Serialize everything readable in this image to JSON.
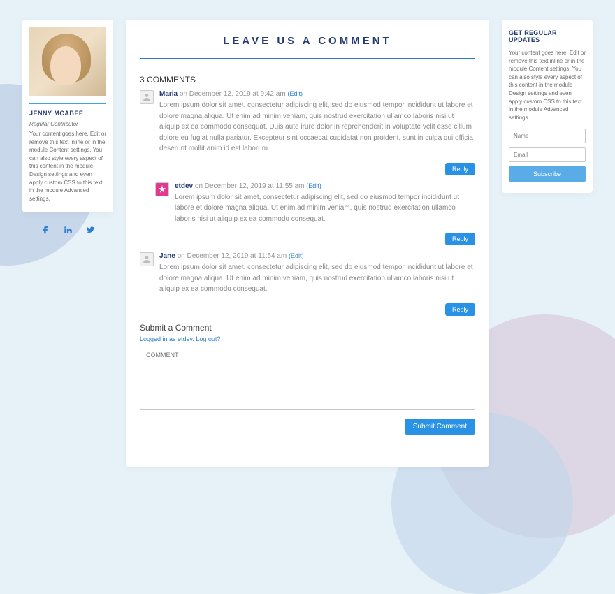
{
  "profile": {
    "name": "JENNY MCABEE",
    "role": "Regular Contributor",
    "description": "Your content goes here. Edit or remove this text inline or in the module Content settings. You can also style every aspect of this content in the module Design settings and even apply custom CSS to this text in the module Advanced settings."
  },
  "main": {
    "title": "LEAVE US A COMMENT",
    "comments_count": "3",
    "comments_label": "COMMENTS",
    "comments": [
      {
        "author": "Maria",
        "date": "on December 12, 2019 at 9:42 am",
        "edit": "(Edit)",
        "text": "Lorem ipsum dolor sit amet, consectetur adipiscing elit, sed do eiusmod tempor incididunt ut labore et dolore magna aliqua. Ut enim ad minim veniam, quis nostrud exercitation ullamco laboris nisi ut aliquip ex ea commodo consequat. Duis aute irure dolor in reprehenderit in voluptate velit esse cillum dolore eu fugiat nulla pariatur. Excepteur sint occaecat cupidatat non proident, sunt in culpa qui officia deserunt mollit anim id est laborum.",
        "reply": "Reply",
        "nested": false,
        "avatar_style": "default"
      },
      {
        "author": "etdev",
        "date": "on December 12, 2019 at 11:55 am",
        "edit": "(Edit)",
        "text": "Lorem ipsum dolor sit amet, consectetur adipiscing elit, sed do eiusmod tempor incididunt ut labore et dolore magna aliqua. Ut enim ad minim veniam, quis nostrud exercitation ullamco laboris nisi ut aliquip ex ea commodo consequat.",
        "reply": "Reply",
        "nested": true,
        "avatar_style": "pink"
      },
      {
        "author": "Jane",
        "date": "on December 12, 2019 at 11:54 am",
        "edit": "(Edit)",
        "text": "Lorem ipsum dolor sit amet, consectetur adipiscing elit, sed do eiusmod tempor incididunt ut labore et dolore magna aliqua. Ut enim ad minim veniam, quis nostrud exercitation ullamco laboris nisi ut aliquip ex ea commodo consequat.",
        "reply": "Reply",
        "nested": false,
        "avatar_style": "default"
      }
    ],
    "submit_heading": "Submit a Comment",
    "login_line": "Logged in as etdev. Log out?",
    "textarea_placeholder": "COMMENT",
    "submit_button": "Submit Comment"
  },
  "updates": {
    "title": "GET REGULAR UPDATES",
    "description": "Your content goes here. Edit or remove this text inline or in the module Content settings. You can also style every aspect of this content in the module Design settings and even apply custom CSS to this text in the module Advanced settings.",
    "name_placeholder": "Name",
    "email_placeholder": "Email",
    "subscribe": "Subscribe"
  }
}
